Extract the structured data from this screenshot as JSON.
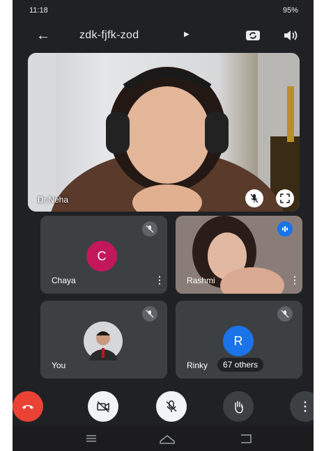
{
  "status_bar": {
    "time_text": "11:18",
    "right_text": "95%"
  },
  "meeting": {
    "code": "zdk-fjfk-zod"
  },
  "main_participant": {
    "name": "Dr.Neha"
  },
  "participants": [
    {
      "name": "Chaya",
      "initial": "C",
      "color": "#c2185b"
    },
    {
      "name": "Rashmi"
    },
    {
      "name": "You"
    },
    {
      "name": "Rinky",
      "initial": "R",
      "color": "#1a73e8"
    }
  ],
  "others_label": "67 others",
  "colors": {
    "end_call": "#ea4335",
    "tile_bg": "#3c4043",
    "app_bg": "#202124"
  },
  "icons": [
    "back-arrow-icon",
    "switch-camera-icon",
    "speaker-icon",
    "mic-off-icon",
    "fullscreen-icon",
    "more-vert-icon",
    "audio-wave-icon",
    "end-call-icon",
    "camera-off-icon",
    "raise-hand-icon"
  ]
}
